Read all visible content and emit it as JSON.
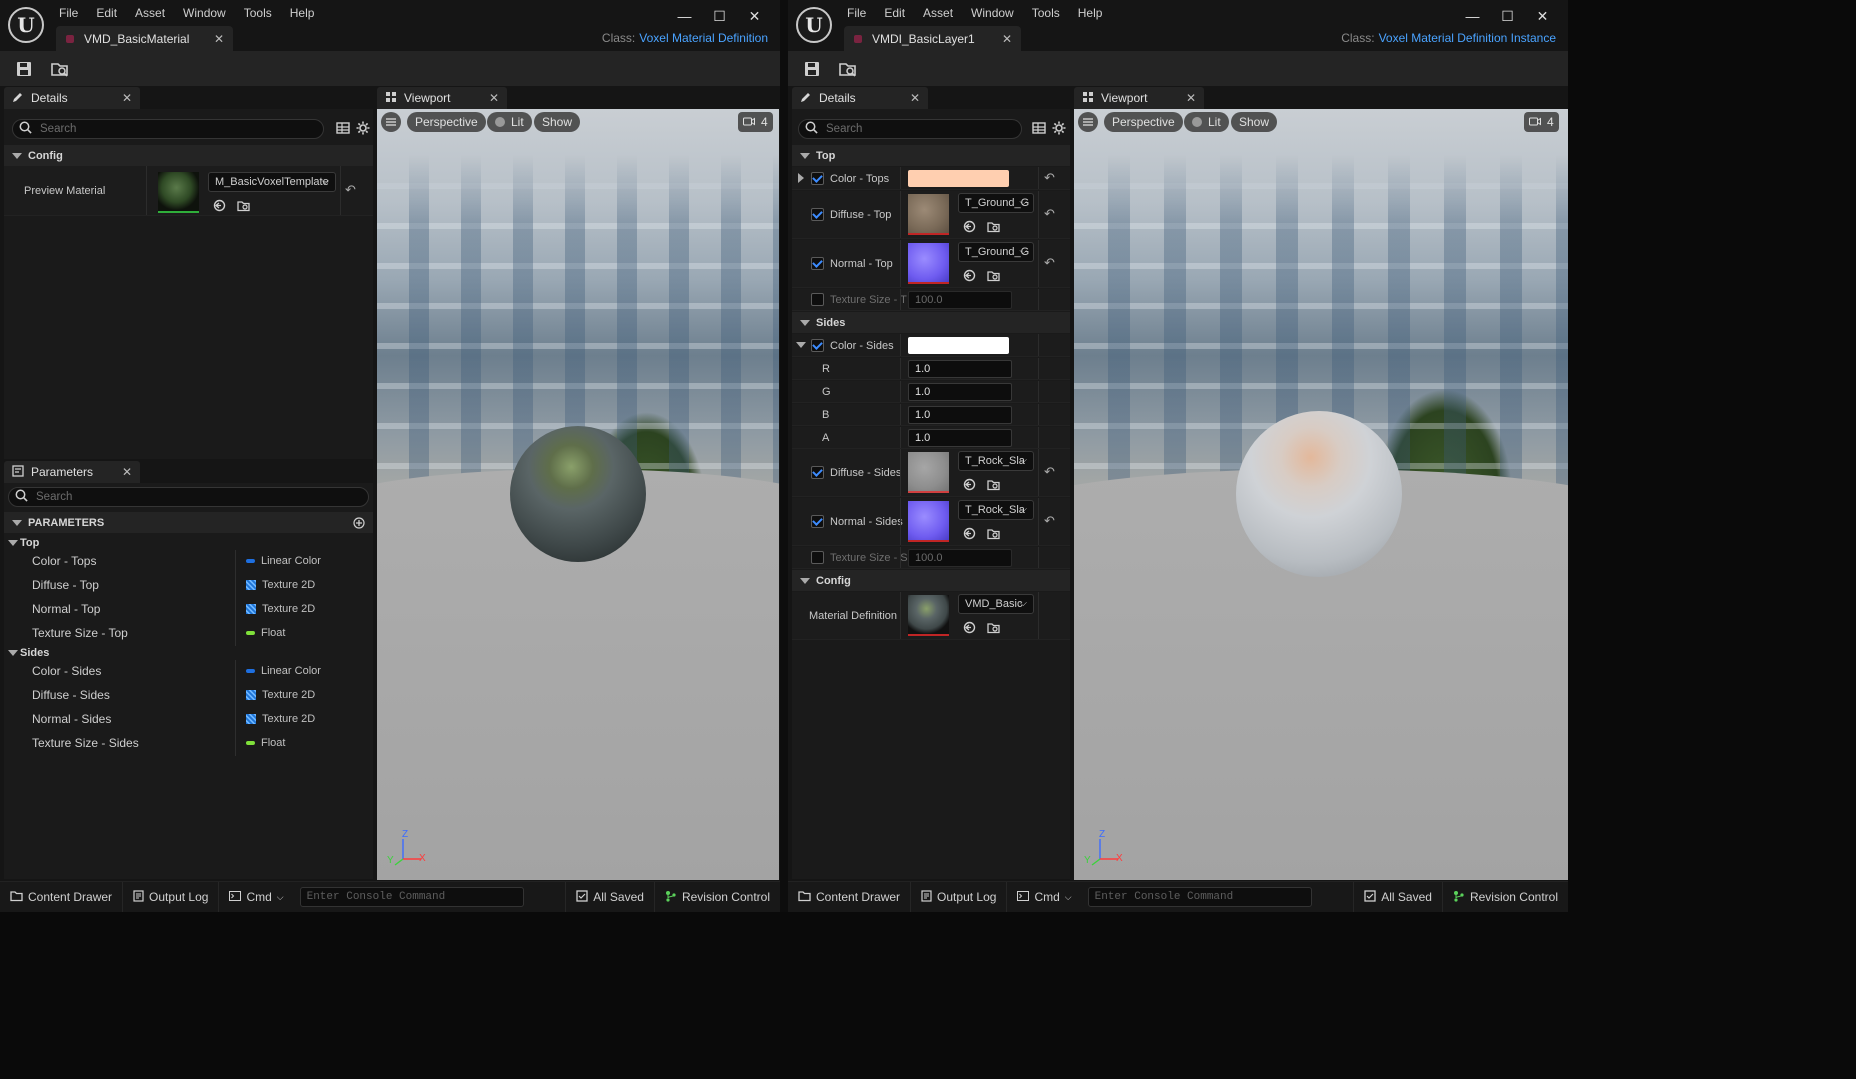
{
  "menu": [
    "File",
    "Edit",
    "Asset",
    "Window",
    "Tools",
    "Help"
  ],
  "colors": {
    "accent": "#4aa3ff",
    "linear_color": "#1e6fe0",
    "float": "#7fe03a",
    "checkbox": "#3d8cff"
  },
  "left": {
    "tab_title": "VMD_BasicMaterial",
    "class_key": "Class:",
    "class_value": "Voxel Material Definition",
    "details": {
      "tab": "Details",
      "search_placeholder": "Search",
      "config_header": "Config",
      "preview_label": "Preview Material",
      "preview_value": "M_BasicVoxelTemplate"
    },
    "parameters": {
      "tab": "Parameters",
      "search_placeholder": "Search",
      "header": "PARAMETERS",
      "groups": [
        {
          "name": "Top",
          "items": [
            {
              "name": "Color - Tops",
              "type": "Linear Color",
              "kind": "color"
            },
            {
              "name": "Diffuse - Top",
              "type": "Texture 2D",
              "kind": "texture"
            },
            {
              "name": "Normal - Top",
              "type": "Texture 2D",
              "kind": "texture"
            },
            {
              "name": "Texture Size - Top",
              "type": "Float",
              "kind": "float"
            }
          ]
        },
        {
          "name": "Sides",
          "items": [
            {
              "name": "Color - Sides",
              "type": "Linear Color",
              "kind": "color"
            },
            {
              "name": "Diffuse - Sides",
              "type": "Texture 2D",
              "kind": "texture"
            },
            {
              "name": "Normal - Sides",
              "type": "Texture 2D",
              "kind": "texture"
            },
            {
              "name": "Texture Size - Sides",
              "type": "Float",
              "kind": "float"
            }
          ]
        }
      ]
    },
    "viewport": {
      "tab": "Viewport",
      "perspective": "Perspective",
      "lit": "Lit",
      "show": "Show",
      "camera_speed": "4",
      "axis_z": "Z",
      "axis_x": "X",
      "axis_y": "Y"
    }
  },
  "right": {
    "tab_title": "VMDI_BasicLayer1",
    "class_key": "Class:",
    "class_value": "Voxel Material Definition Instance",
    "details": {
      "tab": "Details",
      "search_placeholder": "Search",
      "top_header": "Top",
      "color_tops": "Color - Tops",
      "color_tops_value": "#ffcfb0",
      "diffuse_top": "Diffuse - Top",
      "diffuse_top_value": "T_Ground_G",
      "normal_top": "Normal - Top",
      "normal_top_value": "T_Ground_G",
      "texsize_top": "Texture Size - T",
      "texsize_top_value": "100.0",
      "sides_header": "Sides",
      "color_sides": "Color - Sides",
      "color_sides_value": "#ffffff",
      "r_label": "R",
      "r_value": "1.0",
      "g_label": "G",
      "g_value": "1.0",
      "b_label": "B",
      "b_value": "1.0",
      "a_label": "A",
      "a_value": "1.0",
      "diffuse_sides": "Diffuse - Sides",
      "diffuse_sides_value": "T_Rock_Sla",
      "normal_sides": "Normal - Sides",
      "normal_sides_value": "T_Rock_Sla",
      "texsize_sides": "Texture Size - S",
      "texsize_sides_value": "100.0",
      "config_header": "Config",
      "matdef_label": "Material Definition",
      "matdef_value": "VMD_Basic"
    },
    "viewport": {
      "tab": "Viewport",
      "perspective": "Perspective",
      "lit": "Lit",
      "show": "Show",
      "camera_speed": "4",
      "axis_z": "Z",
      "axis_x": "X",
      "axis_y": "Y"
    }
  },
  "status": {
    "content_drawer": "Content Drawer",
    "output_log": "Output Log",
    "cmd": "Cmd",
    "console_placeholder": "Enter Console Command",
    "all_saved": "All Saved",
    "revision_control": "Revision Control"
  }
}
